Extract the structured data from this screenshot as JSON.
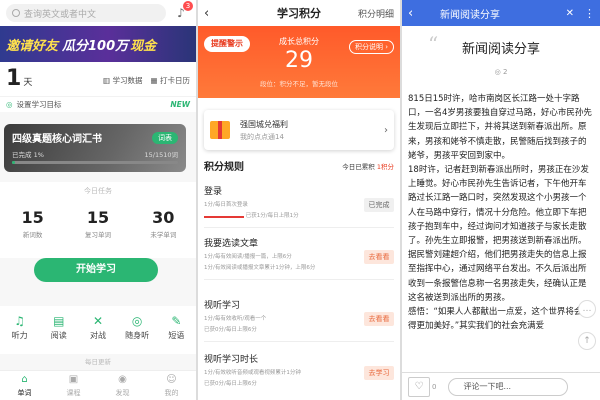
{
  "panel1": {
    "search_placeholder": "查询英文或者中文",
    "bell_badge": "3",
    "banner": {
      "part1": "邀请好友",
      "part2": "瓜分100万",
      "part3": "现金"
    },
    "days_num": "1",
    "days_unit": "天",
    "link_data": "学习数据",
    "link_checkin": "打卡日历",
    "goal_label": "设置学习目标",
    "goal_new": "NEW",
    "book": {
      "title": "四级真题核心词汇书",
      "tag": "词表",
      "progress_left": "已完成 1%",
      "progress_right": "15/1510词",
      "progress": 0.01
    },
    "today_label": "今日任务",
    "stats": [
      {
        "num": "15",
        "label": "新词数"
      },
      {
        "num": "15",
        "label": "复习单词"
      },
      {
        "num": "30",
        "label": "未学单词"
      }
    ],
    "start_label": "开始学习",
    "tools": [
      {
        "icon": "headphone-icon",
        "glyph": "♫",
        "label": "听力"
      },
      {
        "icon": "book-icon",
        "glyph": "▤",
        "label": "阅读"
      },
      {
        "icon": "sword-icon",
        "glyph": "✕",
        "label": "对战"
      },
      {
        "icon": "listen-icon",
        "glyph": "◎",
        "label": "随身听"
      },
      {
        "icon": "pen-icon",
        "glyph": "✎",
        "label": "短语"
      }
    ],
    "mid_label": "每日更新",
    "nav": [
      {
        "icon": "home-icon",
        "glyph": "⌂",
        "label": "单词",
        "active": true
      },
      {
        "icon": "course-icon",
        "glyph": "▣",
        "label": "课程",
        "active": false
      },
      {
        "icon": "discover-icon",
        "glyph": "◉",
        "label": "发现",
        "active": false
      },
      {
        "icon": "user-icon",
        "glyph": "☺",
        "label": "我的",
        "active": false
      }
    ]
  },
  "panel2": {
    "title": "学习积分",
    "detail_link": "积分明细",
    "warn": "提醒警示",
    "caption": "成长总积分",
    "score": "29",
    "sub": "段位：积分不足，暂无段位",
    "explain": "积分说明 ›",
    "county": {
      "title": "强国城兑福利",
      "sub": "我的点点通14"
    },
    "rules_title": "积分规则",
    "today_prefix": "今日已累积",
    "today_value": "1积分",
    "rules": [
      {
        "name": "登录",
        "d1": "1分/每日首次登录",
        "d2": "已获1分/每日上限1分",
        "btn": "已完成",
        "kind": "done"
      },
      {
        "name": "我要选读文章",
        "d1": "1分/每有效阅读/播报一篇，上限6分",
        "d2": "1分/有效阅读或播报文章累计1分钟，上限6分",
        "btn": "去看看",
        "kind": "go"
      },
      {
        "name": "视听学习",
        "d1": "1分/每有效收听/观看一个",
        "d2": "已获0分/每日上限6分",
        "btn": "去看看",
        "kind": "go"
      },
      {
        "name": "视听学习时长",
        "d1": "1分/有效收听音频或观看视频累计1分钟",
        "d2": "已获0分/每日上限6分",
        "btn": "去学习",
        "kind": "go"
      }
    ]
  },
  "panel3": {
    "header_title": "新闻阅读分享",
    "article_title": "新闻阅读分享",
    "views": "2",
    "paragraphs": [
      "815日15时许，哈市南岗区长江路一处十字路口，一名4岁男孩要独自穿过马路，好心市民孙先生发现后立即拦下，并将其送到新春派出所。原来，男孩和姥爷不慎走散，民警随后找到孩子的姥爷，男孩平安回到家中。",
      "18时许，记者赶到新春派出所时，男孩正在沙发上睡觉。好心市民孙先生告诉记者，下午他开车路过长江路一路口时，突然发现这个小男孩一个人在马路中穿行，情况十分危险。他立即下车把孩子抱到车中，经过询问才知道孩子与家长走散了。孙先生立即报警，把男孩送到新春派出所。据民警刘建超介绍，他们把男孩走失的信息上报至指挥中心，通过网络平台发出。不久后派出所收到一条报警信息称一名男孩走失，经确认正是这名被送到派出所的男孩。",
      "感悟：“如果人人都献出一点爱，这个世界将会变得更加美好。”其实我们的社会充满爱"
    ],
    "comment_placeholder": "评论一下吧...",
    "like_count": "0"
  }
}
